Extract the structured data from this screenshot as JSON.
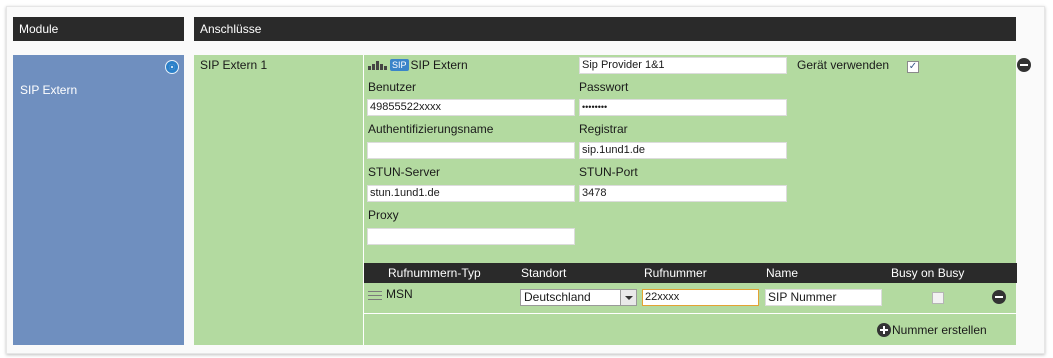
{
  "headers": {
    "module": "Module",
    "connections": "Anschlüsse"
  },
  "module": {
    "name": "SIP Extern",
    "settings_icon": "gear-icon"
  },
  "connection": {
    "name": "SIP Extern 1",
    "device_badge": "SIP",
    "device_type": "SIP Extern",
    "provider_value": "Sip Provider 1&1",
    "use_device_label": "Gerät verwenden",
    "use_device_checked": true,
    "fields": {
      "user_label": "Benutzer",
      "user_value": "49855522xxxx",
      "password_label": "Passwort",
      "password_value": "••••••••",
      "auth_label": "Authentifizierungsname",
      "auth_value": "",
      "registrar_label": "Registrar",
      "registrar_value": "sip.1und1.de",
      "stun_label": "STUN-Server",
      "stun_value": "stun.1und1.de",
      "stun_port_label": "STUN-Port",
      "stun_port_value": "3478",
      "proxy_label": "Proxy",
      "proxy_value": ""
    },
    "numbers": {
      "columns": [
        "Rufnummern-Typ",
        "Standort",
        "Rufnummer",
        "Name",
        "Busy on Busy"
      ],
      "rows": [
        {
          "type": "MSN",
          "location": "Deutschland",
          "number": "22xxxx",
          "name": "SIP Nummer",
          "busy_on_busy": false
        }
      ],
      "create_label": "Nummer erstellen"
    }
  },
  "colors": {
    "header_bg": "#2a2a2a",
    "module_bg": "#6f8fbf",
    "connection_bg": "#b3daa0",
    "active_field_border": "#e3a233"
  }
}
